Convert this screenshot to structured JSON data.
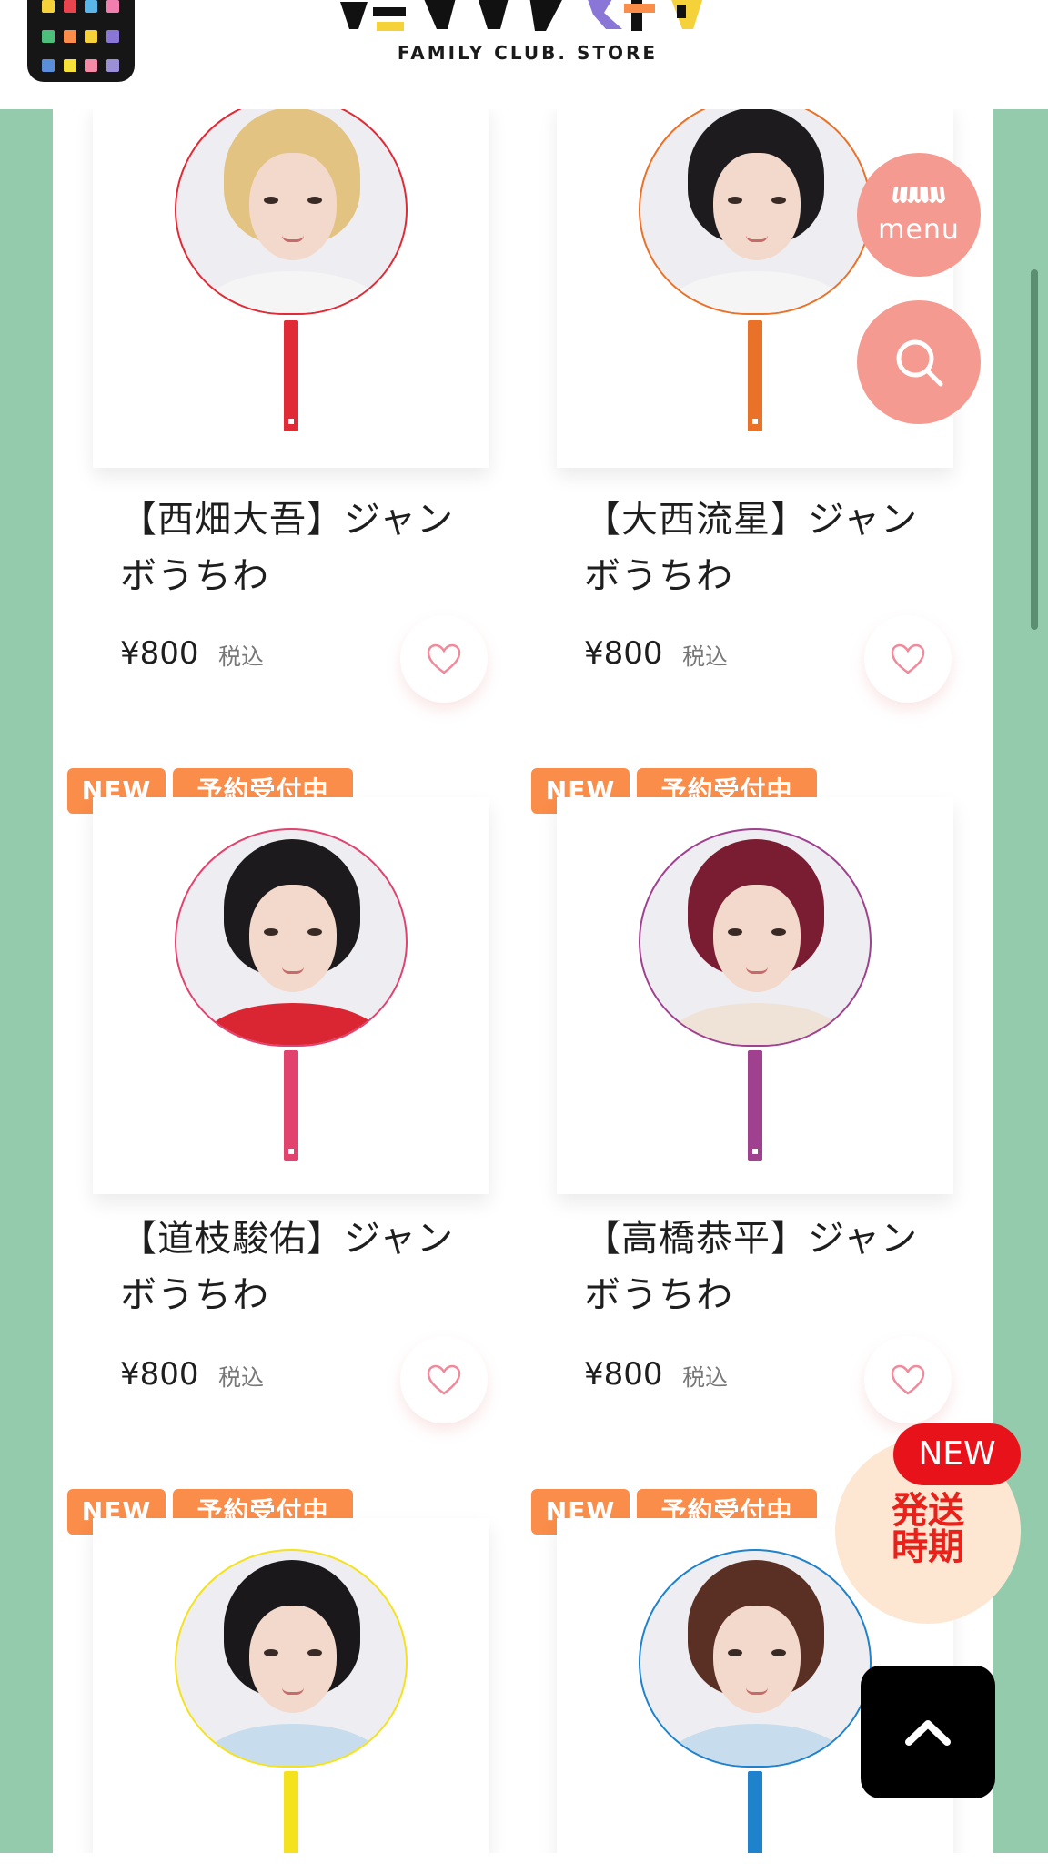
{
  "header": {
    "logo_sub": "FAMILY CLUB. STORE"
  },
  "badges": {
    "new": "NEW",
    "preorder": "予約受付中"
  },
  "products": [
    {
      "title": "【西畑大吾】ジャンボうちわ",
      "price": "¥800",
      "tax": "税込",
      "accent": "#e02a36",
      "hair": "#e3c382"
    },
    {
      "title": "【大西流星】ジャンボうちわ",
      "price": "¥800",
      "tax": "税込",
      "accent": "#ea7128",
      "hair": "#1e1b1e"
    },
    {
      "title": "【道枝駿佑】ジャンボうちわ",
      "price": "¥800",
      "tax": "税込",
      "accent": "#e2436e",
      "hair": "#1d1a1d"
    },
    {
      "title": "【高橋恭平】ジャンボうちわ",
      "price": "¥800",
      "tax": "税込",
      "accent": "#a0418f",
      "hair": "#7a1d32"
    },
    {
      "title": "",
      "price": "",
      "tax": "",
      "accent": "#f4e21e",
      "hair": "#1a181b"
    },
    {
      "title": "",
      "price": "",
      "tax": "",
      "accent": "#1e82cc",
      "hair": "#5a2f24"
    }
  ],
  "floating": {
    "menu_label": "menu",
    "ship_new": "NEW",
    "ship_line1": "発送",
    "ship_line2": "時期"
  },
  "colors": {
    "background_green": "#93cbac",
    "badge_orange": "#fb8d4a",
    "menu_pink": "#f49a91",
    "ship_red": "#e8121a"
  }
}
